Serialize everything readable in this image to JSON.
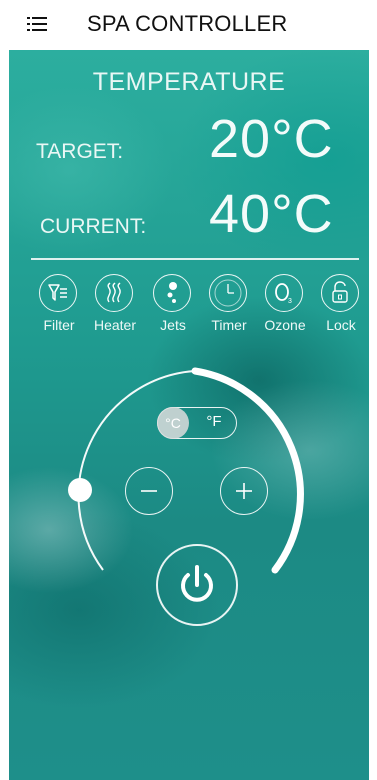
{
  "header": {
    "title": "SPA CONTROLLER",
    "menu_icon": "hamburger-menu-icon"
  },
  "temperature": {
    "heading": "TEMPERATURE",
    "target_label": "TARGET:",
    "target_value": "20°C",
    "current_label": "CURRENT:",
    "current_value": "40°C"
  },
  "features": [
    {
      "label": "Filter",
      "icon": "filter-icon"
    },
    {
      "label": "Heater",
      "icon": "heater-icon"
    },
    {
      "label": "Jets",
      "icon": "jets-icon"
    },
    {
      "label": "Timer",
      "icon": "timer-icon"
    },
    {
      "label": "Ozone",
      "icon": "ozone-icon"
    },
    {
      "label": "Lock",
      "icon": "lock-icon"
    }
  ],
  "control": {
    "unit_celsius": "°C",
    "unit_fahrenheit": "°F",
    "selected_unit": "°C",
    "decrease_icon": "minus-icon",
    "increase_icon": "plus-icon",
    "power_icon": "power-icon"
  },
  "colors": {
    "panel_teal": "#1f9b90",
    "text_light": "#eaf7f5"
  }
}
